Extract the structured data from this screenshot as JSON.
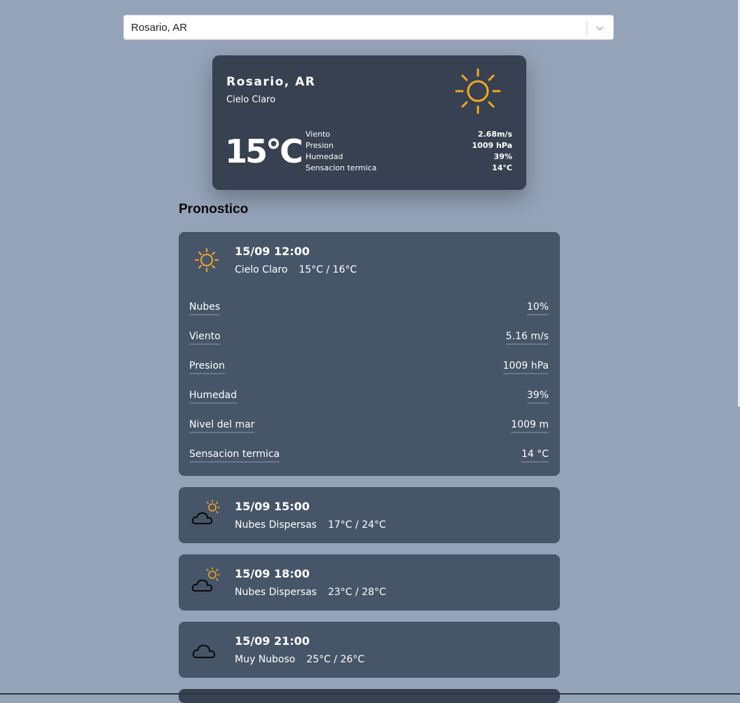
{
  "search": {
    "value": "Rosario, AR"
  },
  "current": {
    "city": "Rosario, AR",
    "description": "Cielo Claro",
    "temperature": "15°C",
    "icon": "sun-icon",
    "details": [
      {
        "label": "Viento",
        "value": "2.68m/s"
      },
      {
        "label": "Presion",
        "value": "1009 hPa"
      },
      {
        "label": "Humedad",
        "value": "39%"
      },
      {
        "label": "Sensacion termica",
        "value": "14°C"
      }
    ]
  },
  "forecast": {
    "title": "Pronostico",
    "items": [
      {
        "time": "15/09 12:00",
        "description": "Cielo Claro",
        "temps": "15°C / 16°C",
        "icon": "sun-icon",
        "details": [
          {
            "label": "Nubes",
            "value": "10%"
          },
          {
            "label": "Viento",
            "value": "5.16 m/s"
          },
          {
            "label": "Presion",
            "value": "1009 hPa"
          },
          {
            "label": "Humedad",
            "value": "39%"
          },
          {
            "label": "Nivel del mar",
            "value": "1009 m"
          },
          {
            "label": "Sensacion termica",
            "value": "14 °C"
          }
        ]
      },
      {
        "time": "15/09 15:00",
        "description": "Nubes Dispersas",
        "temps": "17°C / 24°C",
        "icon": "partly-cloudy-icon"
      },
      {
        "time": "15/09 18:00",
        "description": "Nubes Dispersas",
        "temps": "23°C / 28°C",
        "icon": "partly-cloudy-icon"
      },
      {
        "time": "15/09 21:00",
        "description": "Muy Nuboso",
        "temps": "25°C / 26°C",
        "icon": "cloud-icon"
      }
    ]
  },
  "colors": {
    "background": "#94a3b8",
    "card_dark": "#374151",
    "card": "#475569",
    "sun": "#f5a623"
  }
}
